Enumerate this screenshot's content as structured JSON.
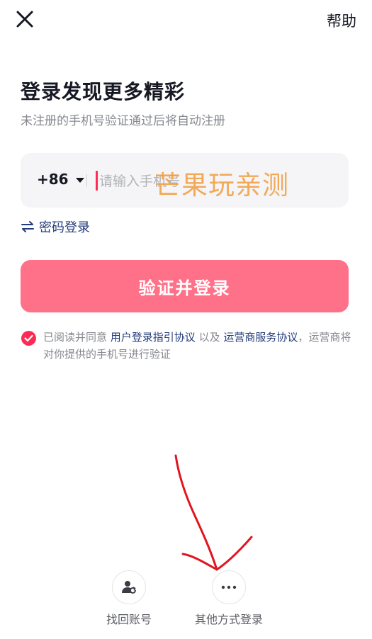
{
  "header": {
    "close_icon": "close-icon",
    "help_label": "帮助"
  },
  "main": {
    "title": "登录发现更多精彩",
    "subtitle": "未注册的手机号验证通过后将自动注册",
    "phone": {
      "country_code": "+86",
      "placeholder": "请输入手机号",
      "value": ""
    },
    "watermark": "芒果玩亲测",
    "password_login_label": "密码登录",
    "submit_label": "验证并登录"
  },
  "agreement": {
    "checked": true,
    "prefix": "已阅读并同意 ",
    "user_agreement": "用户登录指引协议",
    "connector": " 以及 ",
    "operator_agreement": "运营商服务协议",
    "suffix": "，运营商将对你提供的手机号进行验证"
  },
  "bottom": {
    "items": [
      {
        "label": "找回账号",
        "icon": "user-refresh-icon"
      },
      {
        "label": "其他方式登录",
        "icon": "more-dots-icon"
      }
    ]
  },
  "colors": {
    "accent": "#fe2c55",
    "button": "#ff7189",
    "link": "#243d7a",
    "watermark": "#f2a34b"
  }
}
